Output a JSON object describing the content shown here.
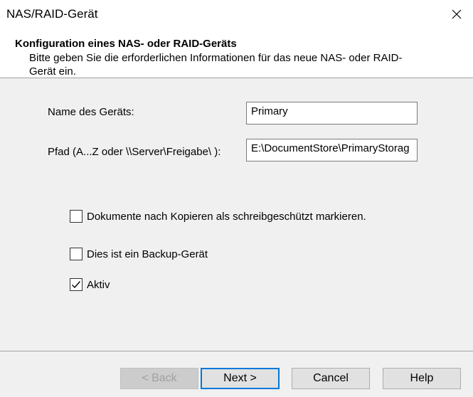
{
  "window": {
    "title": "NAS/RAID-Gerät"
  },
  "header": {
    "title": "Konfiguration eines NAS- oder RAID-Geräts",
    "subtitle": "Bitte geben Sie die erforderlichen Informationen für das neue NAS- oder RAID-Gerät ein."
  },
  "form": {
    "name_label": "Name des Geräts:",
    "name_value": "Primary",
    "path_label": "Pfad (A...Z oder \\\\Server\\Freigabe\\ ):",
    "path_value": "E:\\DocumentStore\\PrimaryStorag"
  },
  "options": {
    "readonly_label": "Dokumente nach Kopieren als schreibgeschützt markieren.",
    "readonly_checked": false,
    "backup_label": "Dies ist ein Backup-Gerät",
    "backup_checked": false,
    "active_label": "Aktiv",
    "active_checked": true
  },
  "buttons": {
    "back": "< Back",
    "next": "Next >",
    "cancel": "Cancel",
    "help": "Help"
  },
  "icons": {
    "close": "close-icon",
    "checkmark": "checkmark-icon"
  }
}
